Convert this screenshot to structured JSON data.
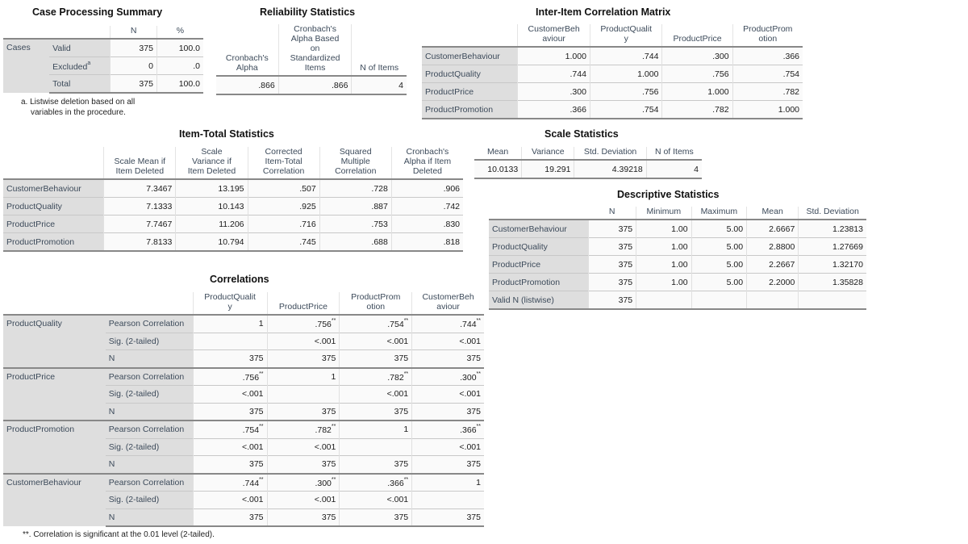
{
  "case_processing": {
    "title": "Case Processing Summary",
    "headers": [
      "N",
      "%"
    ],
    "group_label": "Cases",
    "rows": [
      {
        "label": "Valid",
        "sup": "",
        "n": "375",
        "pct": "100.0"
      },
      {
        "label": "Excluded",
        "sup": "a",
        "n": "0",
        "pct": ".0"
      },
      {
        "label": "Total",
        "sup": "",
        "n": "375",
        "pct": "100.0"
      }
    ],
    "footnote_line1": "a. Listwise deletion based on all",
    "footnote_line2": "variables in the procedure."
  },
  "reliability": {
    "title": "Reliability Statistics",
    "headers": [
      "Cronbach's Alpha",
      "Cronbach's Alpha Based on Standardized Items",
      "N of Items"
    ],
    "values": [
      ".866",
      ".866",
      "4"
    ]
  },
  "inter_item": {
    "title": "Inter-Item Correlation Matrix",
    "columns": [
      "CustomerBehaviour",
      "ProductQuality",
      "ProductPrice",
      "ProductPromotion"
    ],
    "rows": [
      {
        "label": "CustomerBehaviour",
        "values": [
          "1.000",
          ".744",
          ".300",
          ".366"
        ]
      },
      {
        "label": "ProductQuality",
        "values": [
          ".744",
          "1.000",
          ".756",
          ".754"
        ]
      },
      {
        "label": "ProductPrice",
        "values": [
          ".300",
          ".756",
          "1.000",
          ".782"
        ]
      },
      {
        "label": "ProductPromotion",
        "values": [
          ".366",
          ".754",
          ".782",
          "1.000"
        ]
      }
    ]
  },
  "item_total": {
    "title": "Item-Total Statistics",
    "columns": [
      "Scale Mean if Item Deleted",
      "Scale Variance if Item Deleted",
      "Corrected Item-Total Correlation",
      "Squared Multiple Correlation",
      "Cronbach's Alpha if Item Deleted"
    ],
    "rows": [
      {
        "label": "CustomerBehaviour",
        "values": [
          "7.3467",
          "13.195",
          ".507",
          ".728",
          ".906"
        ]
      },
      {
        "label": "ProductQuality",
        "values": [
          "7.1333",
          "10.143",
          ".925",
          ".887",
          ".742"
        ]
      },
      {
        "label": "ProductPrice",
        "values": [
          "7.7467",
          "11.206",
          ".716",
          ".753",
          ".830"
        ]
      },
      {
        "label": "ProductPromotion",
        "values": [
          "7.8133",
          "10.794",
          ".745",
          ".688",
          ".818"
        ]
      }
    ]
  },
  "scale_stats": {
    "title": "Scale Statistics",
    "columns": [
      "Mean",
      "Variance",
      "Std. Deviation",
      "N of Items"
    ],
    "values": [
      "10.0133",
      "19.291",
      "4.39218",
      "4"
    ]
  },
  "descriptive": {
    "title": "Descriptive Statistics",
    "columns": [
      "N",
      "Minimum",
      "Maximum",
      "Mean",
      "Std. Deviation"
    ],
    "rows": [
      {
        "label": "CustomerBehaviour",
        "values": [
          "375",
          "1.00",
          "5.00",
          "2.6667",
          "1.23813"
        ]
      },
      {
        "label": "ProductQuality",
        "values": [
          "375",
          "1.00",
          "5.00",
          "2.8800",
          "1.27669"
        ]
      },
      {
        "label": "ProductPrice",
        "values": [
          "375",
          "1.00",
          "5.00",
          "2.2667",
          "1.32170"
        ]
      },
      {
        "label": "ProductPromotion",
        "values": [
          "375",
          "1.00",
          "5.00",
          "2.2000",
          "1.35828"
        ]
      },
      {
        "label": "Valid N (listwise)",
        "values": [
          "375",
          "",
          "",
          "",
          ""
        ]
      }
    ]
  },
  "correlations": {
    "title": "Correlations",
    "columns": [
      "ProductQuality",
      "ProductPrice",
      "ProductPromotion",
      "CustomerBehaviour"
    ],
    "stat_labels": [
      "Pearson Correlation",
      "Sig. (2-tailed)",
      "N"
    ],
    "groups": [
      {
        "label": "ProductQuality",
        "pearson": [
          [
            "1",
            ""
          ],
          [
            ".756",
            "**"
          ],
          [
            ".754",
            "**"
          ],
          [
            ".744",
            "**"
          ]
        ],
        "sig": [
          "",
          "<.001",
          "<.001",
          "<.001"
        ],
        "n": [
          "375",
          "375",
          "375",
          "375"
        ]
      },
      {
        "label": "ProductPrice",
        "pearson": [
          [
            ".756",
            "**"
          ],
          [
            "1",
            ""
          ],
          [
            ".782",
            "**"
          ],
          [
            ".300",
            "**"
          ]
        ],
        "sig": [
          "<.001",
          "",
          "<.001",
          "<.001"
        ],
        "n": [
          "375",
          "375",
          "375",
          "375"
        ]
      },
      {
        "label": "ProductPromotion",
        "pearson": [
          [
            ".754",
            "**"
          ],
          [
            ".782",
            "**"
          ],
          [
            "1",
            ""
          ],
          [
            ".366",
            "**"
          ]
        ],
        "sig": [
          "<.001",
          "<.001",
          "",
          "<.001"
        ],
        "n": [
          "375",
          "375",
          "375",
          "375"
        ]
      },
      {
        "label": "CustomerBehaviour",
        "pearson": [
          [
            ".744",
            "**"
          ],
          [
            ".300",
            "**"
          ],
          [
            ".366",
            "**"
          ],
          [
            "1",
            ""
          ]
        ],
        "sig": [
          "<.001",
          "<.001",
          "<.001",
          ""
        ],
        "n": [
          "375",
          "375",
          "375",
          "375"
        ]
      }
    ],
    "footnote": "**. Correlation is significant at the 0.01 level (2-tailed)."
  }
}
